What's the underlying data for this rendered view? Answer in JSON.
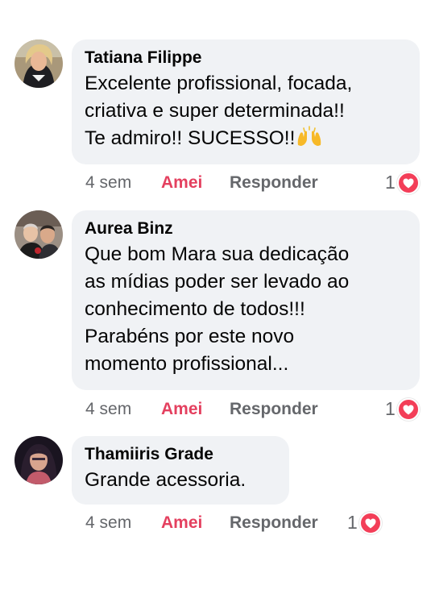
{
  "comments": [
    {
      "author": "Tatiana Filippe",
      "lines": [
        "Excelente profissional, focada,",
        "criativa e super determinada!!",
        "Te admiro!! SUCESSO!!"
      ],
      "emoji": "raising-hands-emoji",
      "time": "4 sem",
      "love_label": "Amei",
      "reply_label": "Responder",
      "reaction_count": "1",
      "reaction_icon": "heart-icon"
    },
    {
      "author": "Aurea Binz",
      "lines": [
        "Que bom Mara sua dedicação",
        "as mídias poder  ser levado ao",
        "conhecimento de todos!!!",
        "Parabéns por este novo",
        "momento profissional..."
      ],
      "time": "4 sem",
      "love_label": "Amei",
      "reply_label": "Responder",
      "reaction_count": "1",
      "reaction_icon": "heart-icon"
    },
    {
      "author": "Thamiiris Grade",
      "lines": [
        "Grande  acessoria."
      ],
      "time": "4 sem",
      "love_label": "Amei",
      "reply_label": "Responder",
      "reaction_count": "1",
      "reaction_icon": "heart-icon"
    }
  ],
  "colors": {
    "bubble": "#f0f2f5",
    "love_accent": "#e4405f",
    "heart_badge": "#f33e58",
    "muted_text": "#65676b"
  }
}
